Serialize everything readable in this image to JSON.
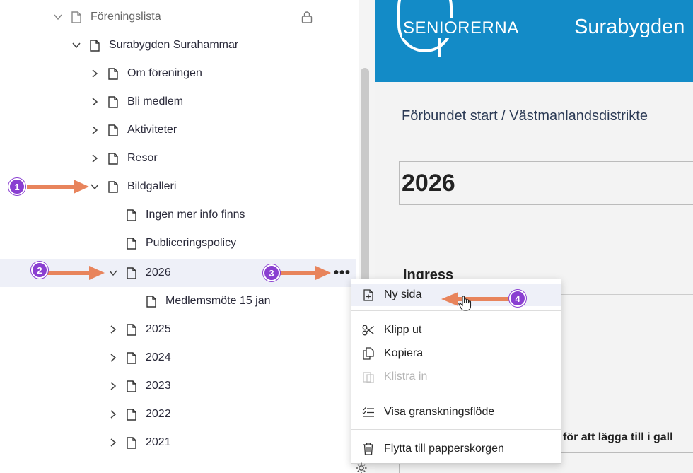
{
  "tree": {
    "root": {
      "label": "Föreningslista",
      "lock_icon": "lock-icon"
    },
    "association": {
      "label": "Surabygden Surahammar"
    },
    "items": [
      {
        "label": "Om föreningen"
      },
      {
        "label": "Bli medlem"
      },
      {
        "label": "Aktiviteter"
      },
      {
        "label": "Resor"
      },
      {
        "label": "Bildgalleri"
      }
    ],
    "bildgalleri_children": [
      {
        "label": "Ingen mer info finns"
      },
      {
        "label": "Publiceringspolicy"
      },
      {
        "label": "2026"
      },
      {
        "label": "Medlemsmöte 15 jan"
      },
      {
        "label": "2025"
      },
      {
        "label": "2024"
      },
      {
        "label": "2023"
      },
      {
        "label": "2022"
      },
      {
        "label": "2021"
      }
    ],
    "more_button": "•••"
  },
  "context_menu": {
    "items": [
      {
        "label": "Ny sida",
        "icon": "new-page-icon"
      },
      {
        "label": "Klipp ut",
        "icon": "scissors-icon"
      },
      {
        "label": "Kopiera",
        "icon": "copy-icon"
      },
      {
        "label": "Klistra in",
        "icon": "paste-icon",
        "disabled": true
      },
      {
        "label": "Visa granskningsflöde",
        "icon": "checklist-icon"
      },
      {
        "label": "Flytta till papperskorgen",
        "icon": "trash-icon"
      }
    ]
  },
  "preview": {
    "logo_text": "SENIORERNA",
    "site_name": "Surabygden",
    "breadcrumb": "Förbundet start  /  Västmanlandsdistrikte",
    "page_title": "2026",
    "ingress_label": "Ingress",
    "gallery_text": "för att lägga till i gall"
  },
  "annotations": {
    "badges": [
      "1",
      "2",
      "3",
      "4"
    ],
    "color": "#8a3fd1",
    "arrow_color": "#e8845c"
  }
}
